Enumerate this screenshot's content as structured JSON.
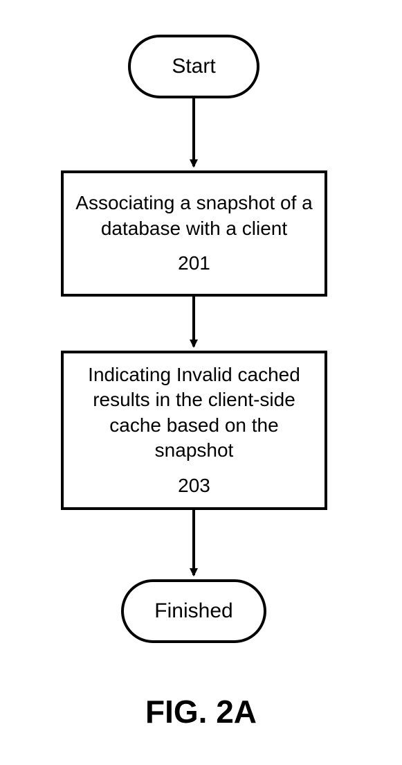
{
  "flowchart": {
    "start": {
      "label": "Start"
    },
    "step1": {
      "text": "Associating a snapshot of a database with a client",
      "number": "201"
    },
    "step2": {
      "text": "Indicating Invalid cached results in the client-side cache based on the snapshot",
      "number": "203"
    },
    "finished": {
      "label": "Finished"
    },
    "caption": "FIG. 2A"
  }
}
